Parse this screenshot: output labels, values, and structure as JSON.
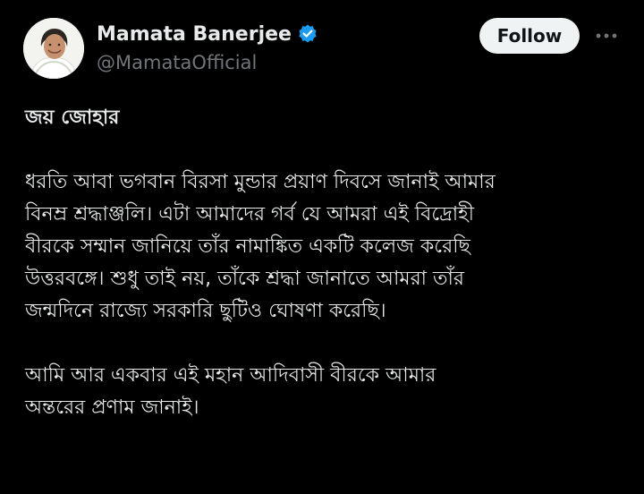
{
  "header": {
    "display_name": "Mamata Banerjee",
    "handle": "@MamataOfficial",
    "follow_label": "Follow",
    "verified_icon": "verified-badge-icon",
    "more_icon": "more-options-icon"
  },
  "tweet": {
    "greeting": "জয় জোহার",
    "para1": [
      "ধরতি আবা ভগবান বিরসা মুন্ডার প্রয়াণ দিবসে জানাই আমার",
      "বিনম্র শ্রদ্ধাঞ্জলি। এটা আমাদের গর্ব যে আমরা এই বিদ্রোহী",
      "বীরকে সম্মান জানিয়ে তাঁর নামাঙ্কিত একটি কলেজ করেছি",
      "উত্তরবঙ্গে। শুধু তাই নয়, তাঁকে শ্রদ্ধা জানাতে আমরা তাঁর",
      "জন্মদিনে রাজ্যে সরকারি ছুটিও ঘোষণা করেছি।"
    ],
    "para2": [
      "আমি আর একবার এই মহান আদিবাসী বীরকে আমার",
      "অন্তরের প্রণাম জানাই।"
    ]
  },
  "colors": {
    "background": "#000000",
    "text_primary": "#e7e9ea",
    "text_secondary": "#71767b",
    "verified_blue": "#1d9bf0",
    "follow_bg": "#eff3f4"
  }
}
